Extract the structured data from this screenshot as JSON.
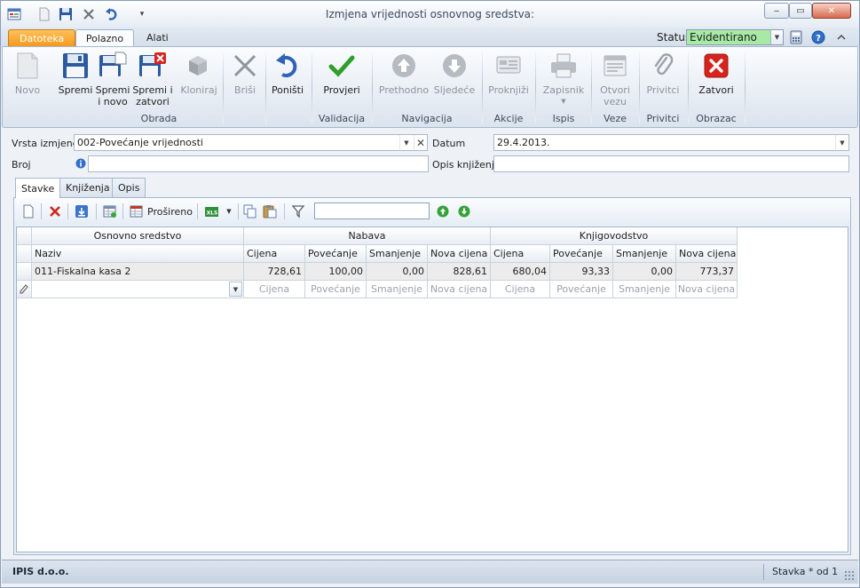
{
  "window": {
    "title": "Izmjena vrijednosti osnovnog sredstva:",
    "minimize": "‒",
    "maximize": "▭",
    "close": "✕"
  },
  "tabs": [
    "Datoteka",
    "Polazno",
    "Alati"
  ],
  "status": {
    "label": "Status",
    "value": "Evidentirano",
    "color": "#a6eaa4"
  },
  "ribbon": {
    "buttons": {
      "novo": "Novo",
      "spremi": "Spremi",
      "spremi_novo_1": "Spremi",
      "spremi_novo_2": "i novo",
      "spremi_zatvori_1": "Spremi i",
      "spremi_zatvori_2": "zatvori",
      "kloniraj": "Kloniraj",
      "brisi": "Briši",
      "ponisti": "Poništi",
      "provjeri": "Provjeri",
      "prethodno": "Prethodno",
      "sljedece": "Sljedeće",
      "proknjizi": "Proknjiži",
      "zapisnik": "Zapisnik",
      "otvori_vezu_1": "Otvori",
      "otvori_vezu_2": "vezu",
      "privitci": "Privitci",
      "zatvori": "Zatvori"
    },
    "groups": {
      "obrada": "Obrada",
      "validacija": "Validacija",
      "navigacija": "Navigacija",
      "akcije": "Akcije",
      "ispis": "Ispis",
      "veze": "Veze",
      "privitci": "Privitci",
      "obrazac": "Obrazac"
    }
  },
  "form": {
    "vrsta_izmjene_label": "Vrsta izmjene",
    "vrsta_izmjene_value": "002-Povećanje vrijednosti",
    "datum_label": "Datum",
    "datum_value": "29.4.2013.",
    "broj_label": "Broj",
    "broj_value": "",
    "opis_label": "Opis knjiženja",
    "opis_value": ""
  },
  "inner_tabs": [
    "Stavke",
    "Knjiženja",
    "Opis"
  ],
  "grid_toolbar": {
    "prosireno": "Prošireno",
    "filter_value": ""
  },
  "grid": {
    "bands": [
      "Osnovno sredstvo",
      "Nabava",
      "Knjigovodstvo"
    ],
    "columns": [
      "Naziv",
      "Cijena",
      "Povećanje",
      "Smanjenje",
      "Nova cijena",
      "Cijena",
      "Povećanje",
      "Smanjenje",
      "Nova cijena"
    ],
    "rows": [
      [
        "011-Fiskalna kasa 2",
        "728,61",
        "100,00",
        "0,00",
        "828,61",
        "680,04",
        "93,33",
        "0,00",
        "773,37"
      ]
    ],
    "new_row_placeholders": [
      "",
      "Cijena",
      "Povećanje",
      "Smanjenje",
      "Nova cijena",
      "Cijena",
      "Povećanje",
      "Smanjenje",
      "Nova cijena"
    ]
  },
  "statusbar": {
    "company": "IPIS d.o.o.",
    "record": "Stavka * od 1"
  }
}
